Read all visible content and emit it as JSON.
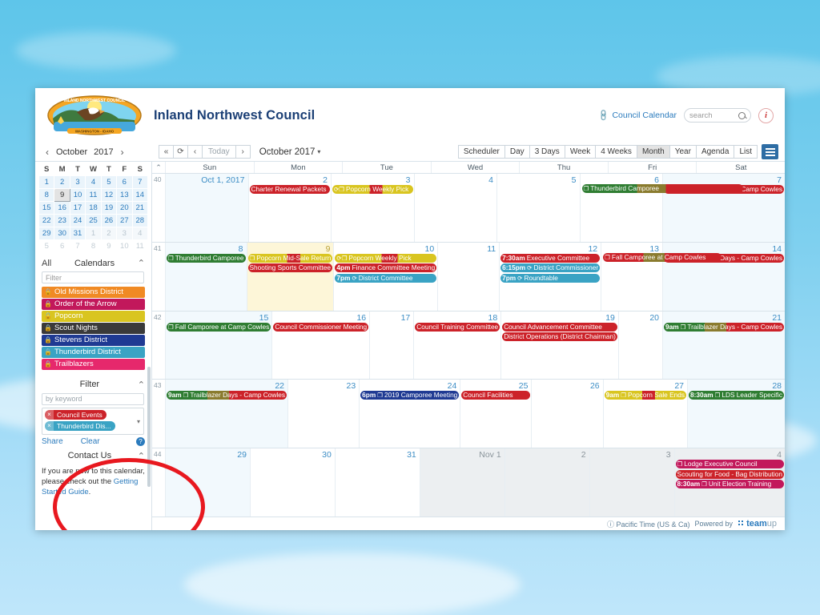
{
  "header": {
    "site_title": "Inland Northwest Council",
    "calendar_link": "Council Calendar",
    "search_placeholder": "search",
    "info_label": "i"
  },
  "nav": {
    "mini_month": "October",
    "mini_year": "2017",
    "prev_label": "‹",
    "next_label": "›",
    "first_label": "«",
    "refresh_label": "⟳",
    "back_label": "‹",
    "today_label": "Today",
    "forward_label": "›",
    "title": "October 2017",
    "views": [
      {
        "label": "Scheduler",
        "active": false
      },
      {
        "label": "Day",
        "active": false
      },
      {
        "label": "3 Days",
        "active": false
      },
      {
        "label": "Week",
        "active": false
      },
      {
        "label": "4 Weeks",
        "active": false
      },
      {
        "label": "Month",
        "active": true
      },
      {
        "label": "Year",
        "active": false
      },
      {
        "label": "Agenda",
        "active": false
      },
      {
        "label": "List",
        "active": false
      }
    ]
  },
  "mini_calendar": {
    "dow": [
      "S",
      "M",
      "T",
      "W",
      "T",
      "F",
      "S"
    ],
    "weeks": [
      [
        {
          "d": "1"
        },
        {
          "d": "2"
        },
        {
          "d": "3"
        },
        {
          "d": "4"
        },
        {
          "d": "5"
        },
        {
          "d": "6"
        },
        {
          "d": "7"
        }
      ],
      [
        {
          "d": "8"
        },
        {
          "d": "9",
          "sel": true
        },
        {
          "d": "10"
        },
        {
          "d": "11"
        },
        {
          "d": "12"
        },
        {
          "d": "13"
        },
        {
          "d": "14"
        }
      ],
      [
        {
          "d": "15"
        },
        {
          "d": "16"
        },
        {
          "d": "17"
        },
        {
          "d": "18"
        },
        {
          "d": "19"
        },
        {
          "d": "20"
        },
        {
          "d": "21"
        }
      ],
      [
        {
          "d": "22"
        },
        {
          "d": "23"
        },
        {
          "d": "24"
        },
        {
          "d": "25"
        },
        {
          "d": "26"
        },
        {
          "d": "27"
        },
        {
          "d": "28"
        }
      ],
      [
        {
          "d": "29"
        },
        {
          "d": "30"
        },
        {
          "d": "31"
        },
        {
          "d": "1",
          "dim": true
        },
        {
          "d": "2",
          "dim": true
        },
        {
          "d": "3",
          "dim": true
        },
        {
          "d": "4",
          "dim": true
        }
      ],
      [
        {
          "d": "5",
          "out": true
        },
        {
          "d": "6",
          "out": true
        },
        {
          "d": "7",
          "out": true
        },
        {
          "d": "8",
          "out": true
        },
        {
          "d": "9",
          "out": true
        },
        {
          "d": "10",
          "out": true
        },
        {
          "d": "11",
          "out": true
        }
      ]
    ]
  },
  "calendars_panel": {
    "all_label": "All",
    "title": "Calendars",
    "collapse_icon": "⌃",
    "filter_placeholder": "Filter",
    "items": [
      {
        "label": "Old Missions District",
        "color": "#f08a24"
      },
      {
        "label": "Order of the Arrow",
        "color": "#c2185b"
      },
      {
        "label": "Popcorn",
        "color": "#d9c520"
      },
      {
        "label": "Scout Nights",
        "color": "#3a3a3a"
      },
      {
        "label": "Stevens District",
        "color": "#1f3a93"
      },
      {
        "label": "Thunderbird District",
        "color": "#3aa3c4"
      },
      {
        "label": "Trailblazers",
        "color": "#e6286c"
      }
    ]
  },
  "filter_panel": {
    "title": "Filter",
    "collapse_icon": "⌃",
    "keyword_placeholder": "by keyword",
    "tags": [
      {
        "label": "Council Events",
        "color": "#cc2229",
        "remove": "×"
      },
      {
        "label": "Thunderbird Dis...",
        "color": "#3aa3c4",
        "remove": "×"
      }
    ],
    "share_label": "Share",
    "clear_label": "Clear",
    "help_label": "?"
  },
  "contact_panel": {
    "title": "Contact Us",
    "collapse_icon": "⌃",
    "text_part1": "If you are new to this calendar, please check out the ",
    "link_text": "Getting Started Guide",
    "text_part2": "."
  },
  "grid": {
    "collapse_icon": "⌃",
    "dow": [
      "Sun",
      "Mon",
      "Tue",
      "Wed",
      "Thu",
      "Fri",
      "Sat"
    ],
    "weeks": [
      {
        "num": "40",
        "days": [
          {
            "label": "Oct 1, 2017",
            "type": "weekend",
            "events": []
          },
          {
            "label": "2",
            "type": "weekday",
            "events": [
              {
                "title": "Charter Renewal Packets",
                "color": "#cc2229",
                "time": "",
                "icon": ""
              }
            ]
          },
          {
            "label": "3",
            "type": "weekday",
            "events": [
              {
                "title": "Popcorn Weekly Pick",
                "color": "#d9c520",
                "time": "",
                "icon": "⟳❐",
                "stripe": true
              }
            ]
          },
          {
            "label": "4",
            "type": "weekday",
            "events": []
          },
          {
            "label": "5",
            "type": "weekday",
            "events": []
          },
          {
            "label": "6",
            "type": "weekday",
            "events": [
              {
                "title": "Thunderbird Camporee",
                "color": "#2f7d32",
                "time": "",
                "icon": "❐",
                "span": 2,
                "multicolor": true
              }
            ]
          },
          {
            "label": "7",
            "type": "weekend",
            "events": [
              {
                "title": "Trailblazer Days - Camp Cowles",
                "color": "#cc2229",
                "time": "9am",
                "icon": "❐"
              }
            ]
          }
        ]
      },
      {
        "num": "41",
        "days": [
          {
            "label": "8",
            "type": "weekend",
            "events": [
              {
                "title": "Thunderbird Camporee",
                "color": "#2f7d32",
                "time": "",
                "icon": "❐"
              }
            ]
          },
          {
            "label": "9",
            "type": "today",
            "events": [
              {
                "title": "Popcorn Mid-Sale Return",
                "color": "#d9c520",
                "time": "",
                "icon": "❐",
                "stripe": true
              },
              {
                "title": "Shooting Sports Committee",
                "color": "#cc2229",
                "time": "",
                "icon": ""
              }
            ]
          },
          {
            "label": "10",
            "type": "weekday",
            "events": [
              {
                "title": "Popcorn Weekly Pick",
                "color": "#d9c520",
                "time": "",
                "icon": "⟳❐",
                "stripe": true
              },
              {
                "title": "Finance Committee Meeting",
                "color": "#cc2229",
                "time": "4pm",
                "icon": ""
              },
              {
                "title": "District Committee",
                "color": "#3aa3c4",
                "time": "7pm",
                "icon": "⟳"
              }
            ]
          },
          {
            "label": "11",
            "type": "weekday",
            "events": []
          },
          {
            "label": "12",
            "type": "weekday",
            "events": [
              {
                "title": "Executive Committee",
                "color": "#cc2229",
                "time": "7:30am",
                "icon": ""
              },
              {
                "title": "District Commissioner",
                "color": "#3aa3c4",
                "time": "6:15pm",
                "icon": "⟳"
              },
              {
                "title": "Roundtable",
                "color": "#3aa3c4",
                "time": "7pm",
                "icon": "⟳"
              }
            ]
          },
          {
            "label": "13",
            "type": "weekday",
            "events": [
              {
                "title": "Fall Camporee at Camp Cowles",
                "color": "#cc2229",
                "time": "",
                "icon": "❐",
                "span": 2,
                "multicolor": true
              }
            ]
          },
          {
            "label": "14",
            "type": "weekend",
            "events": [
              {
                "title": "Trailblazer Days - Camp Cowles",
                "color": "#cc2229",
                "time": "9am",
                "icon": "❐"
              }
            ]
          }
        ]
      },
      {
        "num": "42",
        "days": [
          {
            "label": "15",
            "type": "weekend",
            "events": [
              {
                "title": "Fall Camporee at Camp Cowles",
                "color": "#2f7d32",
                "time": "",
                "icon": "❐"
              }
            ]
          },
          {
            "label": "16",
            "type": "weekday",
            "events": [
              {
                "title": "Council Commissioner Meeting",
                "color": "#cc2229",
                "time": "",
                "icon": ""
              }
            ]
          },
          {
            "label": "17",
            "type": "weekday",
            "events": []
          },
          {
            "label": "18",
            "type": "weekday",
            "events": [
              {
                "title": "Council Training Committee",
                "color": "#cc2229",
                "time": "",
                "icon": ""
              }
            ]
          },
          {
            "label": "19",
            "type": "weekday",
            "events": [
              {
                "title": "Council Advancement Committee",
                "color": "#cc2229",
                "time": "",
                "icon": ""
              },
              {
                "title": "District Operations (District Chairman)",
                "color": "#cc2229",
                "time": "",
                "icon": ""
              }
            ]
          },
          {
            "label": "20",
            "type": "weekday",
            "events": []
          },
          {
            "label": "21",
            "type": "weekend",
            "events": [
              {
                "title": "Trailblazer Days - Camp Cowles",
                "color": "#2f7d32",
                "time": "9am",
                "icon": "❐",
                "multicolor": true
              }
            ]
          }
        ]
      },
      {
        "num": "43",
        "days": [
          {
            "label": "22",
            "type": "weekend",
            "events": [
              {
                "title": "Trailblazer Days - Camp Cowles",
                "color": "#2f7d32",
                "time": "9am",
                "icon": "❐",
                "multicolor": true
              }
            ]
          },
          {
            "label": "23",
            "type": "weekday",
            "events": []
          },
          {
            "label": "24",
            "type": "weekday",
            "events": [
              {
                "title": "2019 Camporee Meeting",
                "color": "#1f3a93",
                "time": "6pm",
                "icon": "❐"
              }
            ]
          },
          {
            "label": "25",
            "type": "weekday",
            "events": [
              {
                "title": "Council Facilities",
                "color": "#cc2229",
                "time": "",
                "icon": ""
              }
            ]
          },
          {
            "label": "26",
            "type": "weekday",
            "events": []
          },
          {
            "label": "27",
            "type": "weekday",
            "events": [
              {
                "title": "Popcorn Sale Ends",
                "color": "#d9c520",
                "time": "9am",
                "icon": "❐",
                "stripe": true
              }
            ]
          },
          {
            "label": "28",
            "type": "weekend",
            "events": [
              {
                "title": "LDS Leader Specific",
                "color": "#2f7d32",
                "time": "8:30am",
                "icon": "❐"
              }
            ]
          }
        ]
      },
      {
        "num": "44",
        "days": [
          {
            "label": "29",
            "type": "weekend",
            "events": []
          },
          {
            "label": "30",
            "type": "weekday",
            "events": []
          },
          {
            "label": "31",
            "type": "weekday",
            "events": []
          },
          {
            "label": "Nov 1",
            "type": "next",
            "events": []
          },
          {
            "label": "2",
            "type": "next",
            "events": []
          },
          {
            "label": "3",
            "type": "next",
            "events": []
          },
          {
            "label": "4",
            "type": "next",
            "events": [
              {
                "title": "Lodge Executive Council",
                "color": "#c2185b",
                "time": "",
                "icon": "❐"
              },
              {
                "title": "Scouting for Food - Bag Distribution",
                "color": "#cc2229",
                "time": "",
                "icon": ""
              },
              {
                "title": "Unit Election Training",
                "color": "#c2185b",
                "time": "8:30am",
                "icon": "❐"
              }
            ]
          }
        ]
      }
    ]
  },
  "footer": {
    "timezone": "Pacific Time (US & Ca)",
    "powered_by": "Powered by",
    "brand": "teamup",
    "brand_suffix": "up"
  }
}
